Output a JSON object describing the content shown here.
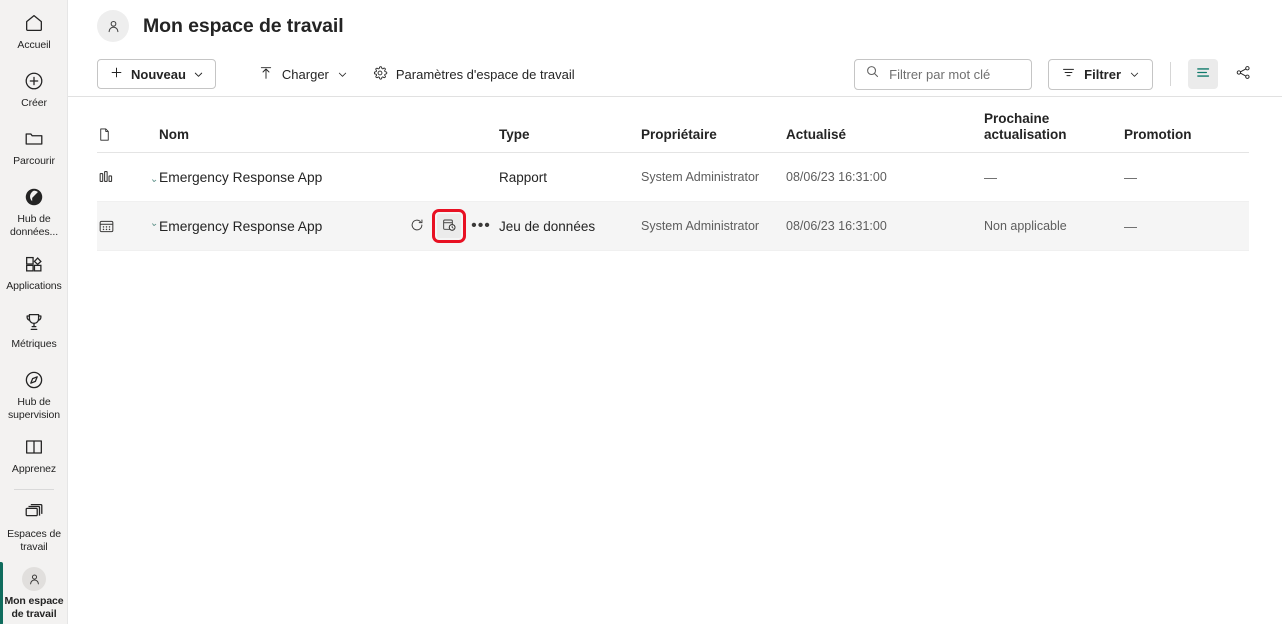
{
  "sidebar": {
    "items": [
      {
        "label": "Accueil",
        "icon": "home-icon",
        "selected": false
      },
      {
        "label": "Créer",
        "icon": "plus-circle-icon",
        "selected": false
      },
      {
        "label": "Parcourir",
        "icon": "folder-icon",
        "selected": false
      },
      {
        "label": "Hub de données...",
        "icon": "data-hub-icon",
        "selected": false
      },
      {
        "label": "Applications",
        "icon": "apps-icon",
        "selected": false
      },
      {
        "label": "Métriques",
        "icon": "trophy-icon",
        "selected": false
      },
      {
        "label": "Hub de supervision",
        "icon": "compass-icon",
        "selected": false
      },
      {
        "label": "Apprenez",
        "icon": "book-icon",
        "selected": false
      },
      {
        "label": "Espaces de travail",
        "icon": "workspaces-icon",
        "selected": false
      },
      {
        "label": "Mon espace de travail",
        "icon": "person-avatar-icon",
        "selected": true
      }
    ]
  },
  "header": {
    "title": "Mon espace de travail",
    "avatar_icon": "person-icon"
  },
  "toolbar": {
    "new_label": "Nouveau",
    "new_icon": "plus-icon",
    "upload_label": "Charger",
    "upload_icon": "upload-arrow-icon",
    "settings_label": "Paramètres d'espace de travail",
    "settings_icon": "gear-icon",
    "chevron_icon": "chevron-down-icon",
    "filter_label": "Filtrer",
    "filter_icon": "filter-lines-icon",
    "list_view_icon": "list-view-icon",
    "lineage_view_icon": "lineage-view-icon",
    "accent_color": "#0f7a6b"
  },
  "search": {
    "placeholder": "Filtrer par mot clé",
    "value": "",
    "icon": "search-icon"
  },
  "table": {
    "columns": [
      {
        "key": "icon",
        "label": "",
        "icon": "document-icon"
      },
      {
        "key": "name",
        "label": "Nom"
      },
      {
        "key": "type",
        "label": "Type"
      },
      {
        "key": "owner",
        "label": "Propriétaire"
      },
      {
        "key": "updated",
        "label": "Actualisé"
      },
      {
        "key": "next_refresh",
        "label": "Prochaine actualisation"
      },
      {
        "key": "promotion",
        "label": "Promotion"
      }
    ],
    "rows": [
      {
        "type_icon": "report-chart-icon",
        "name": "Emergency Response App",
        "endorsement_mark": "⌄",
        "type": "Rapport",
        "owner": "System Administrator",
        "updated": "08/06/23 16:31:00",
        "next_refresh": "—",
        "promotion": "—",
        "hovered": false,
        "actions": []
      },
      {
        "type_icon": "dataset-grid-icon",
        "name": "Emergency Response App",
        "endorsement_mark": "⌄",
        "type": "Jeu de données",
        "owner": "System Administrator",
        "updated": "08/06/23 16:31:00",
        "next_refresh": "Non applicable",
        "promotion": "—",
        "hovered": true,
        "actions": [
          {
            "name": "refresh-now-button",
            "icon": "refresh-icon",
            "highlighted": false
          },
          {
            "name": "schedule-refresh-button",
            "icon": "schedule-refresh-icon",
            "highlighted": true
          },
          {
            "name": "more-options-button",
            "icon": "ellipsis-icon",
            "highlighted": false
          }
        ]
      }
    ]
  },
  "highlight": {
    "color": "#e81123"
  }
}
